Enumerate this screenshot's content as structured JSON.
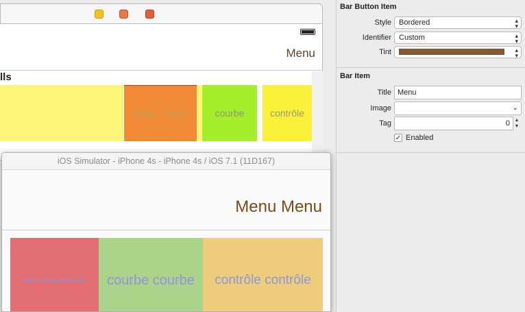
{
  "canvas": {
    "navbar_title": "Menu",
    "label_fragment": "lls",
    "cells": [
      {
        "text": "",
        "color": "#fdf57a"
      },
      {
        "text": "enreg... ments",
        "color": "#f08a35"
      },
      {
        "text": "courbe",
        "color": "#a4ee2c"
      },
      {
        "text": "contrôle",
        "color": "#faf03a"
      }
    ]
  },
  "simulator": {
    "title": "iOS Simulator - iPhone 4s - iPhone 4s / iOS 7.1 (11D167)",
    "nav_title": "Menu Menu",
    "cells": [
      {
        "text": "ments enregistrements",
        "color": "#e26d72"
      },
      {
        "text": "courbe courbe",
        "color": "#acd38a"
      },
      {
        "text": "contrôle contrôle",
        "color": "#edcd7c"
      }
    ]
  },
  "inspector": {
    "bar_button_item": {
      "title": "Bar Button Item",
      "style_label": "Style",
      "style_value": "Bordered",
      "identifier_label": "Identifier",
      "identifier_value": "Custom",
      "tint_label": "Tint",
      "tint_color": "#8b5a2b"
    },
    "bar_item": {
      "title": "Bar Item",
      "title_label": "Title",
      "title_value": "Menu",
      "image_label": "Image",
      "image_value": "",
      "tag_label": "Tag",
      "tag_value": "0",
      "enabled_label": "Enabled",
      "enabled": true
    }
  }
}
